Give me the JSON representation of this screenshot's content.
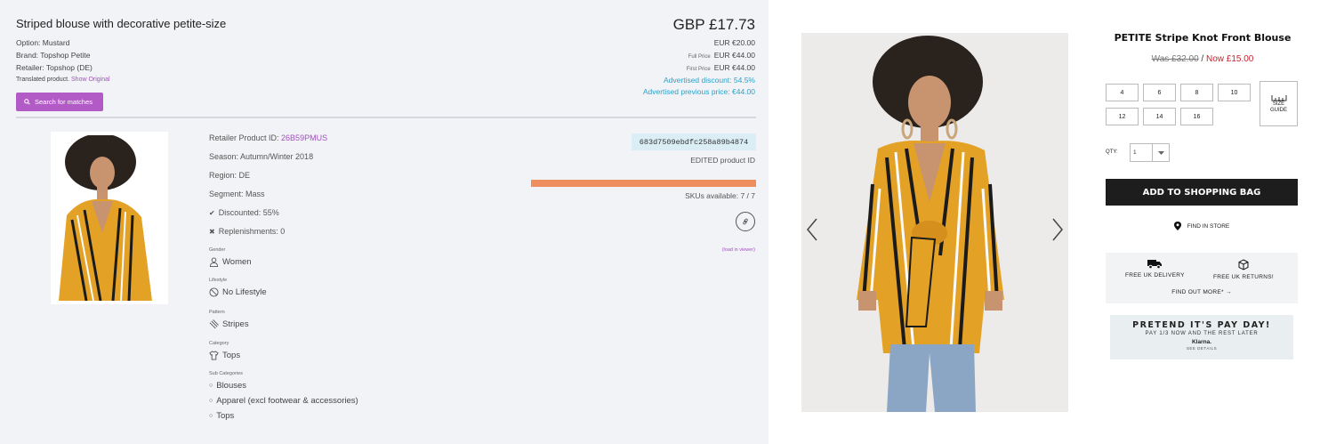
{
  "left": {
    "title": "Striped blouse with decorative petite-size",
    "option": "Option: Mustard",
    "brand": "Brand: Topshop Petite",
    "retailer": "Retailer: Topshop (DE)",
    "translated": "Translated product.",
    "show_original": "Show Original",
    "search_button": "Search for matches",
    "price_main": "GBP £17.73",
    "price_eur": "EUR €20.00",
    "full_price_label": "Full Price",
    "full_price": "EUR €44.00",
    "first_price_label": "First Price",
    "first_price": "EUR €44.00",
    "advertised_discount": "Advertised discount: 54.5%",
    "advertised_previous": "Advertised previous price: €44.00",
    "retailer_product_id_label": "Retailer Product ID:",
    "retailer_product_id": "26B59PMUS",
    "season": "Season: Autumn/Winter 2018",
    "region": "Region: DE",
    "segment": "Segment: Mass",
    "discounted": "Discounted: 55%",
    "replenishments": "Replenishments: 0",
    "gender_label": "Gender",
    "gender": "Women",
    "lifestyle_label": "Lifestyle",
    "lifestyle": "No Lifestyle",
    "pattern_label": "Pattern",
    "pattern": "Stripes",
    "category_label": "Category",
    "category": "Tops",
    "sub_categories_label": "Sub Categories",
    "sub_categories": [
      "Blouses",
      "Apparel (excl footwear & accessories)",
      "Tops"
    ],
    "edited_id": "683d7509ebdfc258a89b4874",
    "edited_id_label": "EDITED product ID",
    "skus_available": "SKUs available: 7 / 7",
    "skus_fraction": 1.0,
    "load_in_viewer": "(load in viewer)"
  },
  "right": {
    "title": "PETITE Stripe Knot Front Blouse",
    "was_price": "Was £32.00",
    "price_sep": " / ",
    "now_price": "Now £15.00",
    "sizes": [
      "4",
      "6",
      "8",
      "10",
      "12",
      "14",
      "16"
    ],
    "size_guide_line1": "SIZE",
    "size_guide_line2": "GUIDE",
    "qty_label": "QTY:",
    "qty_value": "1",
    "bag_button": "ADD TO SHOPPING BAG",
    "find_in_store": "FIND IN STORE",
    "free_delivery": "FREE UK DELIVERY",
    "free_returns": "FREE UK RETURNS!",
    "find_out_more": "FIND OUT MORE* →",
    "payday_heading": "PRETEND IT'S PAY DAY!",
    "payday_sub": "PAY 1/3 NOW AND THE REST LATER",
    "klarna": "Klarna.",
    "see_details": "SEE DETAILS"
  },
  "colors": {
    "accent_purple": "#b25ac6",
    "link_blue": "#2da0c8",
    "sku_bar": "#ee8d5e",
    "now_red": "#c7222f"
  }
}
